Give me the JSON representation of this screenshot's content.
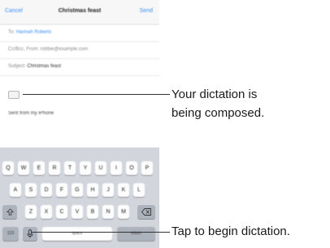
{
  "nav": {
    "cancel_label": "Cancel",
    "title": "Christmas feast",
    "send_label": "Send"
  },
  "fields": {
    "to_label": "To:",
    "to_value": "Hannah Roberts",
    "ccbcc_text": "Cc/Bcc, From: robbie@example.com",
    "subject_label": "Subject:",
    "subject_value": "Christmas feast"
  },
  "body": {
    "signature": "Sent from my iPhone"
  },
  "keyboard": {
    "row1": [
      "Q",
      "W",
      "E",
      "R",
      "T",
      "Y",
      "U",
      "I",
      "O",
      "P"
    ],
    "row2": [
      "A",
      "S",
      "D",
      "F",
      "G",
      "H",
      "J",
      "K",
      "L"
    ],
    "row3": [
      "Z",
      "X",
      "C",
      "V",
      "B",
      "N",
      "M"
    ],
    "shift_icon": "shift-arrow-icon",
    "delete_icon": "delete-icon",
    "numbers_label": "123",
    "dictation_icon": "microphone-icon",
    "space_label": "space",
    "return_label": "return"
  },
  "callouts": {
    "composing_line1": "Your dictation is",
    "composing_line2": "being composed.",
    "tap_text": "Tap to begin dictation."
  }
}
